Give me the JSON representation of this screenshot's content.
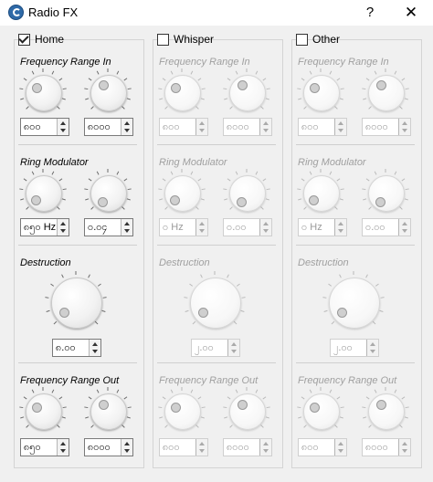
{
  "window": {
    "title": "Radio FX",
    "help_label": "?",
    "close_label": "✕"
  },
  "presets": [
    {
      "label": "Home",
      "checked": true,
      "enabled": true,
      "freq_in": {
        "title": "Frequency Range In",
        "low": "၈၀၀",
        "high": "၈၀၀၀"
      },
      "ring": {
        "title": "Ring Modulator",
        "freq": "၈၅၀ Hz",
        "amount": "၀.၀၄"
      },
      "destruction": {
        "title": "Destruction",
        "value": "၈.၀၀"
      },
      "freq_out": {
        "title": "Frequency Range Out",
        "low": "၈၅၀",
        "high": "၈၀၀၀"
      }
    },
    {
      "label": "Whisper",
      "checked": false,
      "enabled": false,
      "freq_in": {
        "title": "Frequency Range In",
        "low": "၈၀၀",
        "high": "၈၀၀၀"
      },
      "ring": {
        "title": "Ring Modulator",
        "freq": "၀ Hz",
        "amount": "၀.၀၀"
      },
      "destruction": {
        "title": "Destruction",
        "value": "၂.၀၀"
      },
      "freq_out": {
        "title": "Frequency Range Out",
        "low": "၈၀၀",
        "high": "၈၀၀၀"
      }
    },
    {
      "label": "Other",
      "checked": false,
      "enabled": false,
      "freq_in": {
        "title": "Frequency Range In",
        "low": "၈၀၀",
        "high": "၈၀၀၀"
      },
      "ring": {
        "title": "Ring Modulator",
        "freq": "၀ Hz",
        "amount": "၀.၀၀"
      },
      "destruction": {
        "title": "Destruction",
        "value": "၂.၀၀"
      },
      "freq_out": {
        "title": "Frequency Range Out",
        "low": "၈၀၀",
        "high": "၈၀၀၀"
      }
    }
  ]
}
